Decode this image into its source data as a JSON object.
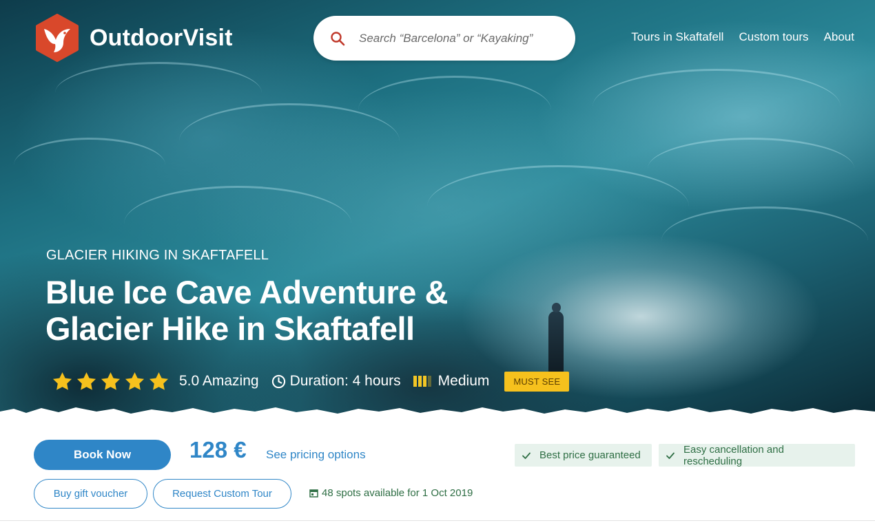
{
  "brand": {
    "name": "OutdoorVisit",
    "logo_color": "#d9482b"
  },
  "search": {
    "placeholder": "Search “Barcelona” or “Kayaking”",
    "icon": "search-icon",
    "icon_color": "#c0392b"
  },
  "nav": {
    "items": [
      {
        "label": "Tours in Skaftafell"
      },
      {
        "label": "Custom tours"
      },
      {
        "label": "About"
      }
    ]
  },
  "hero": {
    "eyebrow": "GLACIER HIKING IN SKAFTAFELL",
    "title": "Blue Ice Cave Adventure & Glacier Hike in Skaftafell",
    "rating": {
      "stars": 5,
      "max_stars": 5,
      "label": "5.0 Amazing",
      "star_color": "#f6c11d"
    },
    "duration": {
      "icon": "clock-icon",
      "label": "Duration: 4 hours"
    },
    "difficulty": {
      "icon": "difficulty-icon",
      "level": 3,
      "max_level": 4,
      "label": "Medium"
    },
    "badge": "MUST SEE"
  },
  "booking": {
    "book_label": "Book Now",
    "price": "128 €",
    "pricing_link": "See pricing options",
    "guarantees": [
      {
        "label": "Best price guaranteed"
      },
      {
        "label": "Easy cancellation and rescheduling"
      }
    ],
    "gift_label": "Buy gift voucher",
    "custom_label": "Request Custom Tour",
    "availability": "48 spots available for 1 Oct 2019",
    "accent_color": "#2f86c7",
    "success_color": "#2e6e44"
  }
}
